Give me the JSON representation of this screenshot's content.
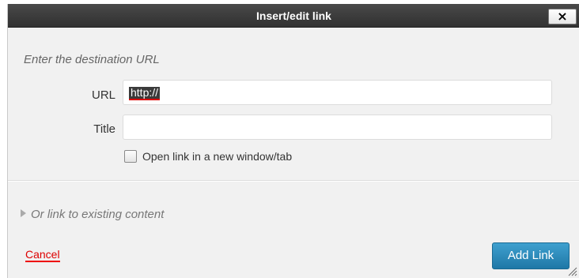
{
  "dialog": {
    "title": "Insert/edit link",
    "close_label": "×"
  },
  "form": {
    "prompt": "Enter the destination URL",
    "url_label": "URL",
    "url_value": "http://",
    "title_label": "Title",
    "title_value": "",
    "new_window_label": "Open link in a new window/tab",
    "new_window_checked": false
  },
  "existing": {
    "toggle_label": "Or link to existing content",
    "icon": "triangle-right-icon"
  },
  "actions": {
    "cancel_label": "Cancel",
    "submit_label": "Add Link"
  },
  "colors": {
    "titlebar": "#3a3a3a",
    "primary_button": "#2a87b8",
    "cancel_link": "#dd0000",
    "dialog_bg": "#f1f1f1"
  }
}
